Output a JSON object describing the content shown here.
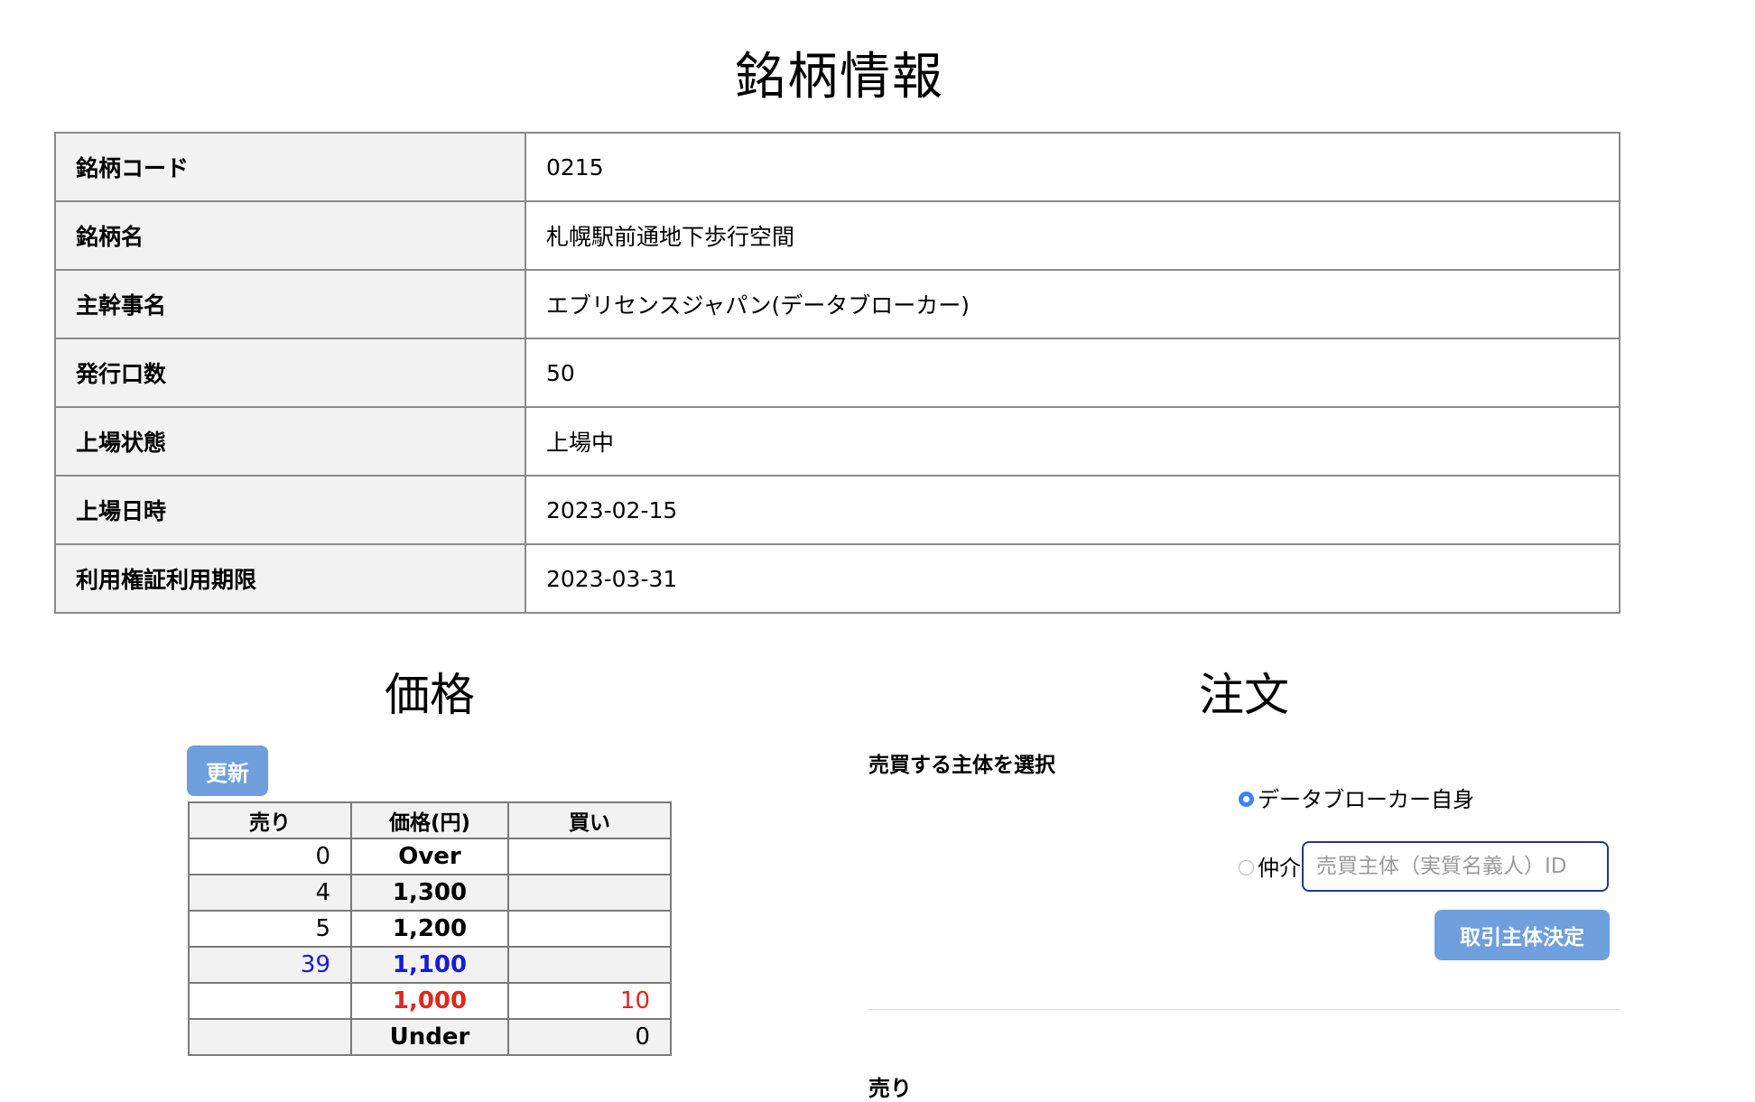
{
  "page_title": "銘柄情報",
  "info_rows": [
    {
      "label": "銘柄コード",
      "value": "0215"
    },
    {
      "label": "銘柄名",
      "value": "札幌駅前通地下歩行空間"
    },
    {
      "label": "主幹事名",
      "value": "エブリセンスジャパン(データブローカー)"
    },
    {
      "label": "発行口数",
      "value": "50"
    },
    {
      "label": "上場状態",
      "value": "上場中"
    },
    {
      "label": "上場日時",
      "value": "2023-02-15"
    },
    {
      "label": "利用権証利用期限",
      "value": "2023-03-31"
    }
  ],
  "price_section": {
    "title": "価格",
    "refresh_label": "更新",
    "headers": {
      "sell": "売り",
      "price": "価格(円)",
      "buy": "買い"
    },
    "rows": [
      {
        "sell": "0",
        "price": "Over",
        "buy": ""
      },
      {
        "sell": "4",
        "price": "1,300",
        "buy": ""
      },
      {
        "sell": "5",
        "price": "1,200",
        "buy": ""
      },
      {
        "sell": "39",
        "price": "1,100",
        "buy": ""
      },
      {
        "sell": "",
        "price": "1,000",
        "buy": "10"
      },
      {
        "sell": "",
        "price": "Under",
        "buy": "0"
      }
    ],
    "colors": {
      "best_ask": "#1a1ad6",
      "best_bid": "#e0281e"
    }
  },
  "order_section": {
    "title": "注文",
    "entity_label": "売買する主体を選択",
    "option_self": "データブローカー自身",
    "option_broker": "仲介",
    "selected": "option_self",
    "input_placeholder": "売買主体（実質名義人）ID",
    "input_value": "",
    "decide_label": "取引主体決定",
    "sell_heading": "売り"
  },
  "accent_color": "#6f9fdd"
}
